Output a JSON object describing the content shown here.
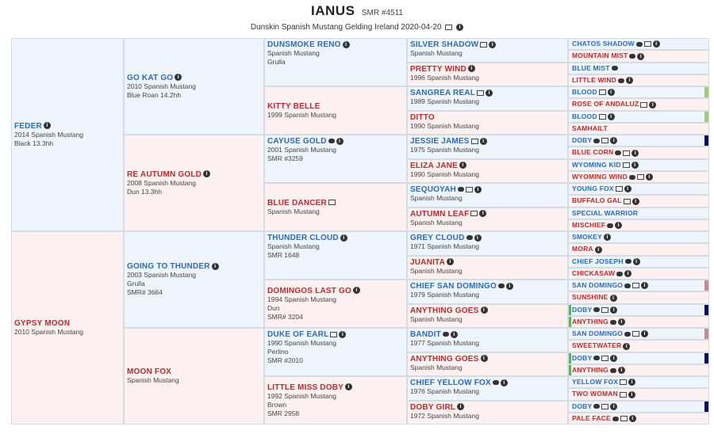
{
  "header": {
    "name": "IANUS",
    "registration": "SMR #4511",
    "subtitle": "Dunskin Spanish Mustang Gelding Ireland 2020-04-20"
  },
  "gen1": [
    {
      "name": "FEDER",
      "lines": [
        "2014 Spanish Mustang",
        "Black 13.3hh"
      ],
      "icons": [
        "info"
      ]
    },
    {
      "name": "GYPSY MOON",
      "lines": [
        "2010 Spanish Mustang"
      ],
      "icons": []
    }
  ],
  "gen2": [
    {
      "name": "GO KAT GO",
      "lines": [
        "2010 Spanish Mustang",
        "Blue Roan 14.2hh"
      ],
      "icons": [
        "info"
      ]
    },
    {
      "name": "RE AUTUMN GOLD",
      "lines": [
        "2008 Spanish Mustang",
        "Dun 13.3hh"
      ],
      "icons": [
        "info"
      ]
    },
    {
      "name": "GOING TO THUNDER",
      "lines": [
        "2003 Spanish Mustang",
        "Grulla",
        "SMR# 3664"
      ],
      "icons": [
        "info"
      ]
    },
    {
      "name": "MOON FOX",
      "lines": [
        "Spanish Mustang"
      ],
      "icons": []
    }
  ],
  "gen3": [
    {
      "name": "DUNSMOKE RENO",
      "lines": [
        "Spanish Mustang",
        "Grulla"
      ],
      "icons": [
        "info"
      ]
    },
    {
      "name": "KITTY BELLE",
      "lines": [
        "1999 Spanish Mustang"
      ],
      "icons": []
    },
    {
      "name": "CAYUSE GOLD",
      "lines": [
        "2001 Spanish Mustang",
        "SMR #3259"
      ],
      "icons": [
        "cmt",
        "info"
      ]
    },
    {
      "name": "BLUE DANCER",
      "lines": [
        "Spanish Mustang"
      ],
      "icons": [
        "img"
      ]
    },
    {
      "name": "THUNDER CLOUD",
      "lines": [
        "Spanish Mustang",
        "SMR 1648"
      ],
      "icons": [
        "info"
      ]
    },
    {
      "name": "DOMINGOS LAST GO",
      "lines": [
        "1994 Spanish Mustang",
        "Dun",
        "SMR# 3204"
      ],
      "icons": [
        "info"
      ]
    },
    {
      "name": "DUKE OF EARL",
      "lines": [
        "1990 Spanish Mustang",
        "Perlino",
        "SMR #2010"
      ],
      "icons": [
        "img",
        "info"
      ]
    },
    {
      "name": "LITTLE MISS DOBY",
      "lines": [
        "1992 Spanish Mustang",
        "Brown",
        "SMR 2958"
      ],
      "icons": [
        "info"
      ]
    }
  ],
  "gen4": [
    {
      "name": "SILVER SHADOW",
      "lines": [
        "Spanish Mustang"
      ],
      "icons": [
        "img",
        "info"
      ]
    },
    {
      "name": "PRETTY WIND",
      "lines": [
        "1996 Spanish Mustang"
      ],
      "icons": [
        "info"
      ]
    },
    {
      "name": "SANGREA REAL",
      "lines": [
        "1989 Spanish Mustang"
      ],
      "icons": [
        "img",
        "info"
      ]
    },
    {
      "name": "DITTO",
      "lines": [
        "1990 Spanish Mustang"
      ],
      "icons": []
    },
    {
      "name": "JESSIE JAMES",
      "lines": [
        "1975 Spanish Mustang"
      ],
      "icons": [
        "img",
        "info"
      ]
    },
    {
      "name": "ELIZA JANE",
      "lines": [
        "1990 Spanish Mustang"
      ],
      "icons": [
        "info"
      ]
    },
    {
      "name": "SEQUOYAH",
      "lines": [
        "Spanish Mustang"
      ],
      "icons": [
        "cmt",
        "img",
        "info"
      ]
    },
    {
      "name": "AUTUMN LEAF",
      "lines": [
        "Spanish Mustang"
      ],
      "icons": [
        "img",
        "info"
      ]
    },
    {
      "name": "GREY CLOUD",
      "lines": [
        "1971 Spanish Mustang"
      ],
      "icons": [
        "cmt",
        "info"
      ]
    },
    {
      "name": "JUANITA",
      "lines": [
        "Spanish Mustang"
      ],
      "icons": [
        "info"
      ]
    },
    {
      "name": "CHIEF SAN DOMINGO",
      "lines": [
        "1979 Spanish Mustang"
      ],
      "icons": [
        "cmt",
        "info"
      ]
    },
    {
      "name": "ANYTHING GOES",
      "lines": [
        "Spanish Mustang"
      ],
      "icons": [
        "info"
      ]
    },
    {
      "name": "BANDIT",
      "lines": [
        "1977 Spanish Mustang"
      ],
      "icons": [
        "cmt",
        "info"
      ]
    },
    {
      "name": "ANYTHING GOES",
      "lines": [
        "Spanish Mustang"
      ],
      "icons": [
        "info"
      ]
    },
    {
      "name": "CHIEF YELLOW FOX",
      "lines": [
        "1976 Spanish Mustang"
      ],
      "icons": [
        "cmt",
        "info"
      ]
    },
    {
      "name": "DOBY GIRL",
      "lines": [
        "1972 Spanish Mustang"
      ],
      "icons": [
        "info"
      ]
    }
  ],
  "gen5": [
    {
      "name": "CHATOS SHADOW",
      "icons": [
        "cmt",
        "img",
        "info"
      ]
    },
    {
      "name": "MOUNTAIN MIST",
      "icons": [
        "cmt",
        "info"
      ]
    },
    {
      "name": "BLUE MIST",
      "icons": [
        "cmt"
      ]
    },
    {
      "name": "LITTLE WIND",
      "icons": [
        "cmt",
        "info"
      ]
    },
    {
      "name": "BLOOD",
      "icons": [
        "img",
        "info"
      ],
      "swatch": "#a3c77e"
    },
    {
      "name": "ROSE OF ANDALUZ",
      "icons": [
        "img",
        "info"
      ]
    },
    {
      "name": "BLOOD",
      "icons": [
        "img",
        "info"
      ],
      "swatch": "#a3c77e"
    },
    {
      "name": "SAMHAILT",
      "icons": []
    },
    {
      "name": "DOBY",
      "icons": [
        "cmt",
        "img",
        "info"
      ],
      "swatch": "#0a0a5a"
    },
    {
      "name": "BLUE CORN",
      "icons": [
        "cmt",
        "img",
        "info"
      ]
    },
    {
      "name": "WYOMING KID",
      "icons": [
        "img",
        "info"
      ]
    },
    {
      "name": "WYOMING WIND",
      "icons": [
        "cmt",
        "img",
        "info"
      ]
    },
    {
      "name": "YOUNG FOX",
      "icons": [
        "img",
        "info"
      ]
    },
    {
      "name": "BUFFALO GAL",
      "icons": [
        "img",
        "info"
      ]
    },
    {
      "name": "SPECIAL WARRIOR",
      "icons": []
    },
    {
      "name": "MISCHIEF",
      "icons": [
        "cmt",
        "info"
      ]
    },
    {
      "name": "SMOKEY",
      "icons": [
        "info"
      ]
    },
    {
      "name": "MORA",
      "icons": [
        "info"
      ]
    },
    {
      "name": "CHIEF JOSEPH",
      "icons": [
        "cmt",
        "info"
      ]
    },
    {
      "name": "CHICKASAW",
      "icons": [
        "cmt",
        "info"
      ]
    },
    {
      "name": "SAN DOMINGO",
      "icons": [
        "cmt",
        "img",
        "info"
      ],
      "swatch": "#c48a9a"
    },
    {
      "name": "SUNSHINE",
      "icons": [
        "info"
      ]
    },
    {
      "name": "DOBY",
      "icons": [
        "cmt",
        "img",
        "info"
      ],
      "swatch": "#0a0a5a",
      "leftbar": true
    },
    {
      "name": "ANYTHING",
      "icons": [
        "cmt",
        "info"
      ],
      "leftbar": true
    },
    {
      "name": "SAN DOMINGO",
      "icons": [
        "cmt",
        "img",
        "info"
      ],
      "swatch": "#c48a9a"
    },
    {
      "name": "SWEETWATER",
      "icons": [
        "info"
      ]
    },
    {
      "name": "DOBY",
      "icons": [
        "cmt",
        "img",
        "info"
      ],
      "swatch": "#0a0a5a",
      "leftbar": true
    },
    {
      "name": "ANYTHING",
      "icons": [
        "cmt",
        "info"
      ],
      "leftbar": true
    },
    {
      "name": "YELLOW FOX",
      "icons": [
        "img",
        "info"
      ]
    },
    {
      "name": "TWO WOMAN",
      "icons": [
        "img",
        "info"
      ]
    },
    {
      "name": "DOBY",
      "icons": [
        "cmt",
        "img",
        "info"
      ],
      "swatch": "#0a0a5a"
    },
    {
      "name": "PALE FACE",
      "icons": [
        "cmt",
        "img",
        "info"
      ]
    }
  ]
}
